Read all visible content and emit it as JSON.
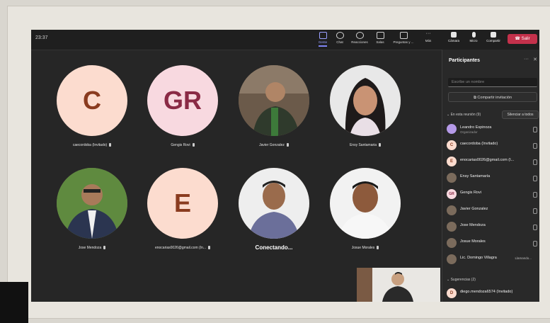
{
  "clock": "23:37",
  "toolbar": {
    "items": [
      {
        "label": "Gente",
        "icon": "people-icon"
      },
      {
        "label": "Chat",
        "icon": "chat-icon"
      },
      {
        "label": "Reacciones",
        "icon": "reactions-icon"
      },
      {
        "label": "Salas",
        "icon": "rooms-icon"
      },
      {
        "label": "Preguntas y ...",
        "icon": "qa-icon"
      },
      {
        "label": "Más",
        "icon": "more-icon"
      }
    ],
    "right": [
      {
        "label": "Cámara",
        "icon": "camera-icon"
      },
      {
        "label": "Micro",
        "icon": "microphone-icon"
      },
      {
        "label": "Compartir",
        "icon": "share-icon"
      }
    ],
    "leave_label": "Salir"
  },
  "tiles": [
    {
      "initials": "C",
      "name": "caecordoba (Invitado)"
    },
    {
      "initials": "GR",
      "name": "Gengis Rovi"
    },
    {
      "initials": "",
      "name": "Javier Gonzalez"
    },
    {
      "initials": "",
      "name": "Ensy Santamaria"
    },
    {
      "initials": "",
      "name": "Jose Mendoza"
    },
    {
      "initials": "E",
      "name": "enocarias0026@gmail.com (In..."
    },
    {
      "initials": "",
      "name": "Conectando..."
    },
    {
      "initials": "",
      "name": "Josue Morales"
    }
  ],
  "panel": {
    "title": "Participantes",
    "search_placeholder": "Escribe un nombre",
    "share_invite": "Compartir invitación",
    "in_meeting": "En esta reunión (9)",
    "mute_all": "Silenciar a todos",
    "participants": [
      {
        "initial": "",
        "name": "Leandro Espinoza",
        "sub": "Organizador"
      },
      {
        "initial": "C",
        "name": "caecordoba (Invitado)",
        "sub": ""
      },
      {
        "initial": "E",
        "name": "enocarias0026@gmail.com (I...",
        "sub": ""
      },
      {
        "initial": "",
        "name": "Ensy Santamaría",
        "sub": ""
      },
      {
        "initial": "GR",
        "name": "Gengis Rovi",
        "sub": ""
      },
      {
        "initial": "",
        "name": "Javier Gonzalez",
        "sub": ""
      },
      {
        "initial": "",
        "name": "Jose Mendoza",
        "sub": ""
      },
      {
        "initial": "",
        "name": "Josue Morales",
        "sub": ""
      },
      {
        "initial": "",
        "name": "Lic. Domingo Villagra",
        "sub": "",
        "status": "Llamando..."
      }
    ],
    "suggestions": "Sugerencias (2)",
    "suggested": [
      {
        "initial": "D",
        "name": "diego.mendoza6574 (Invitado)"
      }
    ]
  }
}
